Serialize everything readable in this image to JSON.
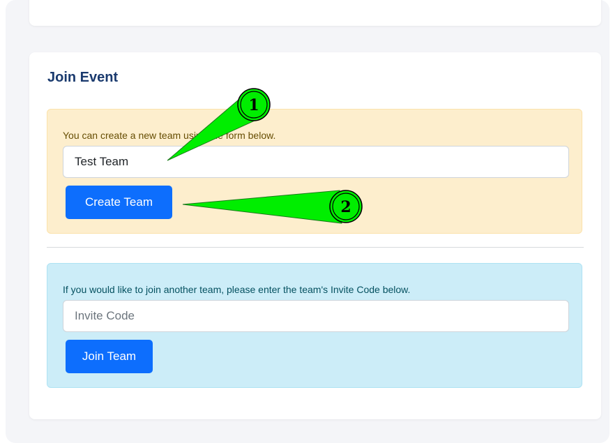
{
  "card": {
    "title": "Join Event"
  },
  "create": {
    "prompt": "You can create a new team using the form below.",
    "team_name_value": "Test Team",
    "button_label": "Create Team"
  },
  "join": {
    "prompt": "If you would like to join another team, please enter the team's Invite Code below.",
    "invite_placeholder": "Invite Code",
    "button_label": "Join Team"
  },
  "annotations": [
    {
      "label": "1",
      "target": "team-name-input"
    },
    {
      "label": "2",
      "target": "create-team-button"
    }
  ],
  "colors": {
    "primary": "#0d6efd",
    "warning_bg": "#fdeecd",
    "info_bg": "#ccedf8",
    "title": "#1a3a6e",
    "annotation_arrow": "#00ee00"
  }
}
